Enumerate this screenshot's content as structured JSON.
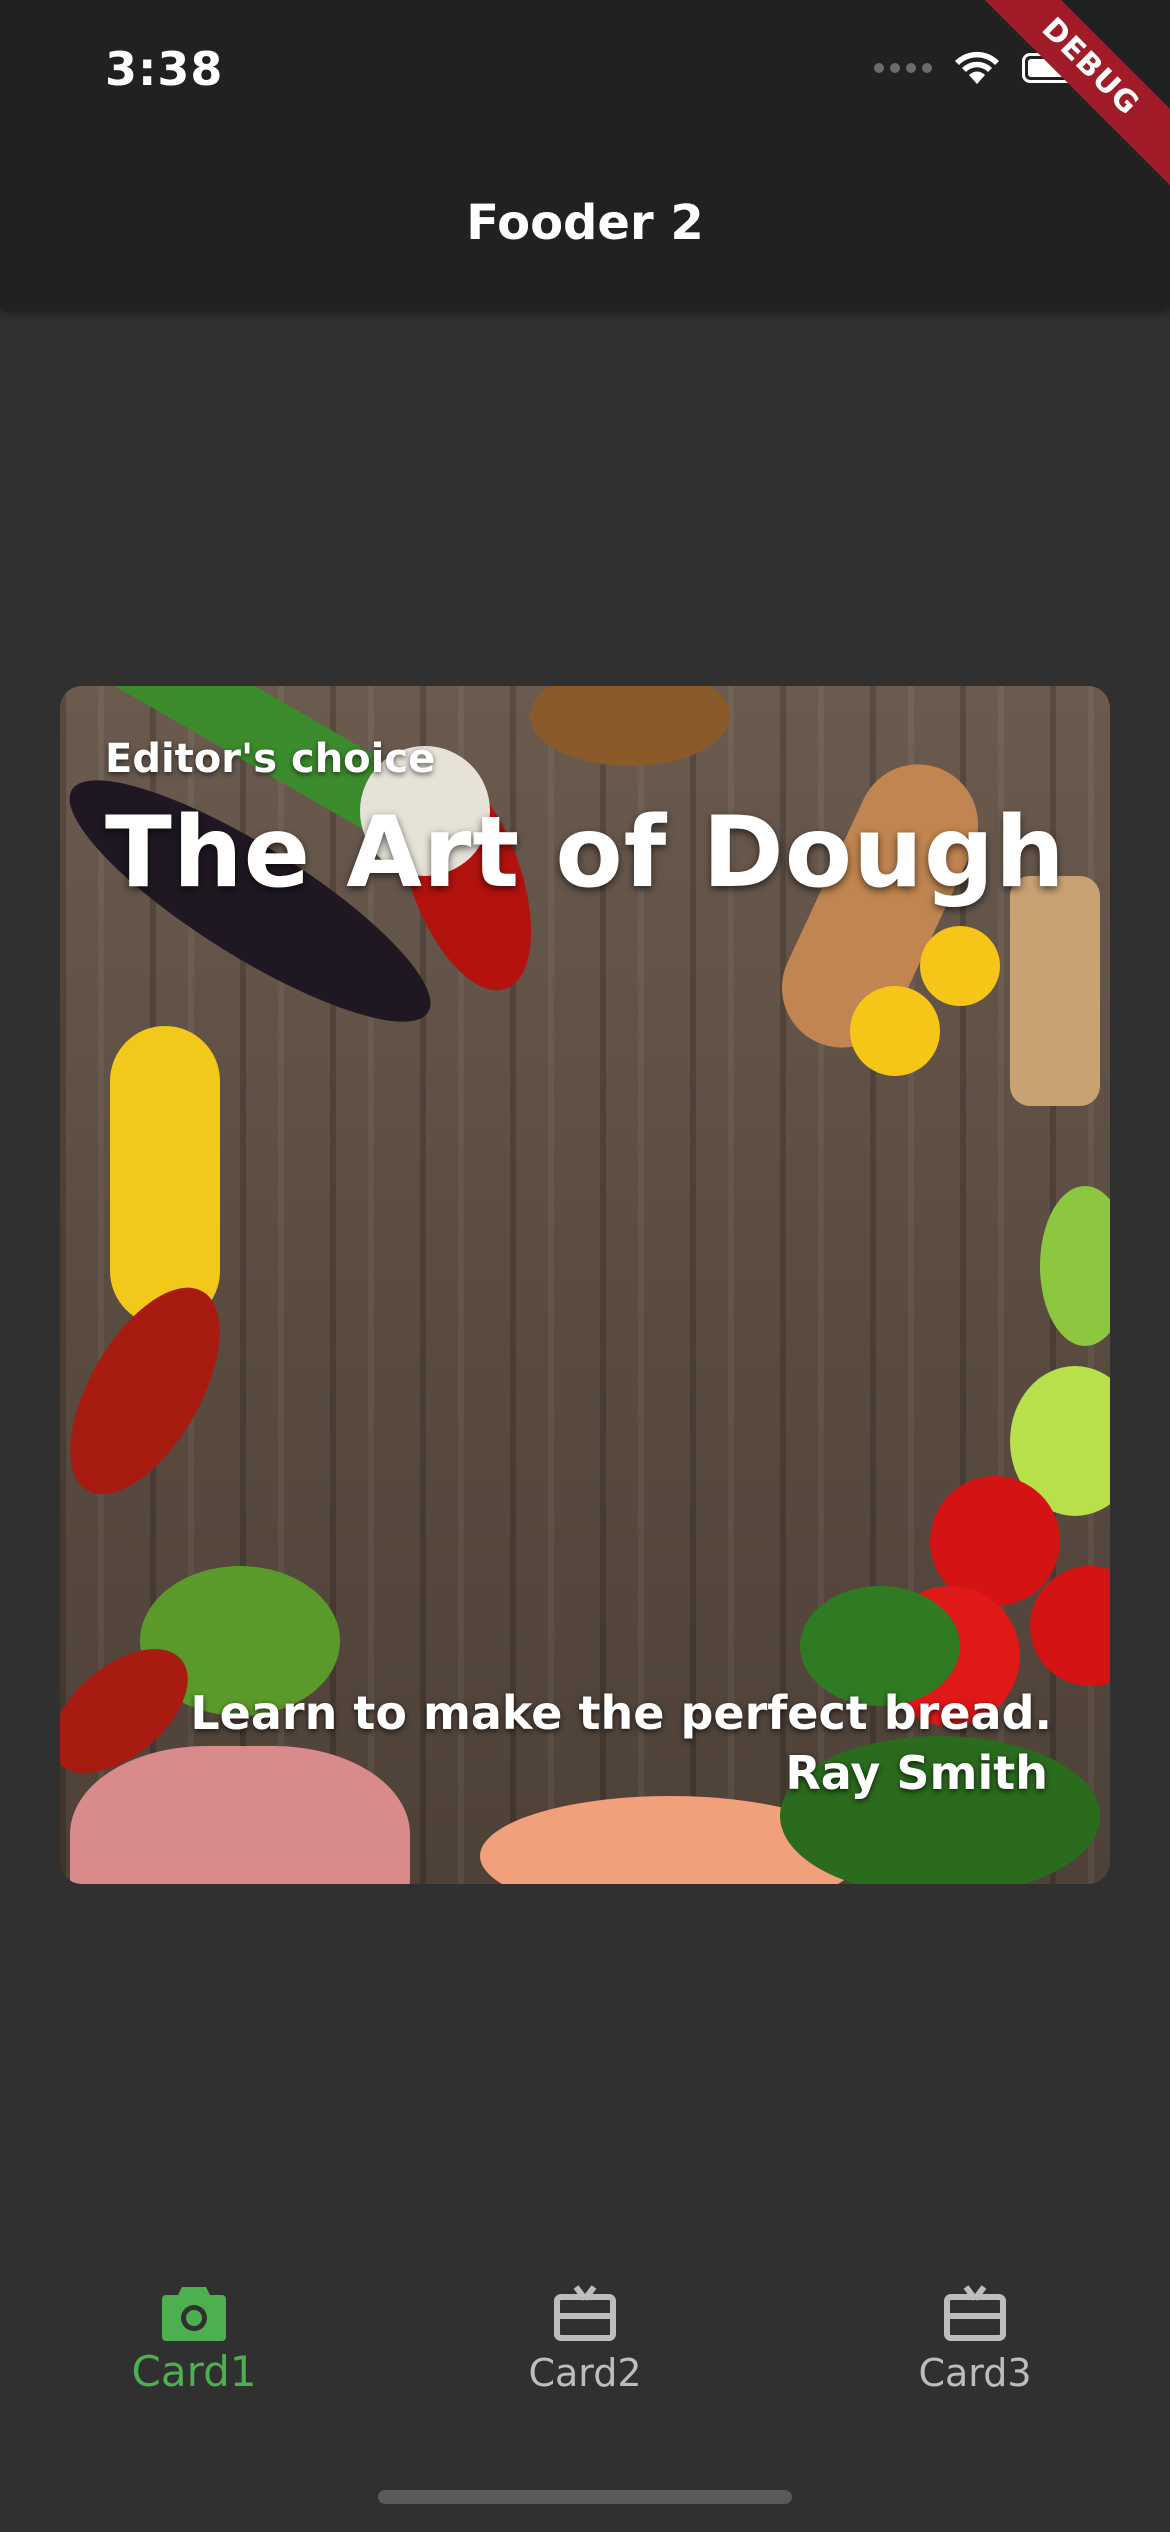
{
  "status_bar": {
    "time": "3:38",
    "icons": [
      "cellular-signal-icon",
      "wifi-icon",
      "battery-icon"
    ]
  },
  "debug_banner": "DEBUG",
  "app_bar": {
    "title": "Fooder 2"
  },
  "card": {
    "category": "Editor's choice",
    "title": "The Art of Dough",
    "description": "Learn to make the perfect bread.",
    "author": "Ray Smith"
  },
  "bottom_nav": {
    "items": [
      {
        "label": "Card1",
        "icon": "camera-icon",
        "active": true
      },
      {
        "label": "Card2",
        "icon": "card-giftcard-icon",
        "active": false
      },
      {
        "label": "Card3",
        "icon": "card-giftcard-icon",
        "active": false
      }
    ],
    "active_color": "#4caf50",
    "inactive_color": "#bdbdbd"
  },
  "colors": {
    "background": "#303030",
    "app_bar": "#212121",
    "debug_banner": "#a11b28"
  }
}
